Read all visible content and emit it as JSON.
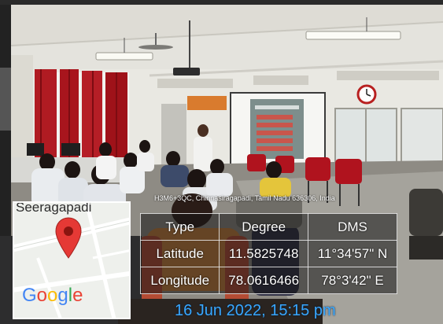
{
  "overlay": {
    "address": "H3M6+3QC, Chinnasiragapadi, Tamil Nadu 636306, India",
    "map": {
      "place_label": "Seeragapadi",
      "logo_text": "Google",
      "logo_letters": [
        {
          "ch": "G",
          "color": "#4285f4"
        },
        {
          "ch": "o",
          "color": "#ea4335"
        },
        {
          "ch": "o",
          "color": "#fbbc05"
        },
        {
          "ch": "g",
          "color": "#4285f4"
        },
        {
          "ch": "l",
          "color": "#34a853"
        },
        {
          "ch": "e",
          "color": "#ea4335"
        }
      ],
      "pin_icon": "map-pin-icon",
      "pin_color": "#e53935"
    },
    "coords": {
      "header": {
        "type": "Type",
        "degree": "Degree",
        "dms": "DMS"
      },
      "latitude": {
        "type": "Latitude",
        "degree": "11.5825748",
        "dms": "11°34'57\" N"
      },
      "longitude": {
        "type": "Longitude",
        "degree": "78.0616466",
        "dms": "78°3'42\" E"
      }
    },
    "timestamp": "16 Jun 2022, 15:15 pm"
  },
  "scene": {
    "projector_slide_lines": 5,
    "wall_clock_icon": "clock-icon",
    "colors": {
      "curtain": "#b01b22",
      "chair": "#b0131e",
      "wall": "#e9e8e2",
      "timestamp": "#39a7ff"
    }
  }
}
